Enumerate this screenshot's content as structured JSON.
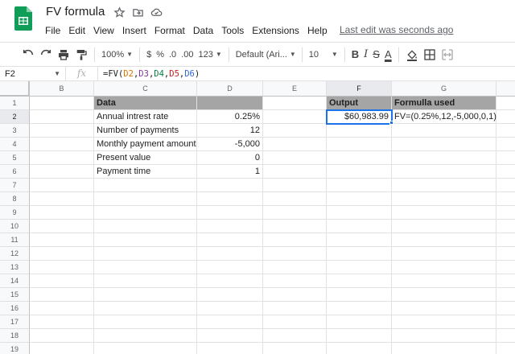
{
  "doc": {
    "title": "FV formula",
    "last_edit": "Last edit was seconds ago"
  },
  "menu": [
    "File",
    "Edit",
    "View",
    "Insert",
    "Format",
    "Data",
    "Tools",
    "Extensions",
    "Help"
  ],
  "toolbar": {
    "zoom": "100%",
    "currency": "$",
    "percent": "%",
    "dec_decrease": ".0",
    "dec_increase": ".00",
    "more_formats": "123",
    "font": "Default (Ari...",
    "font_size": "10",
    "bold": "B",
    "italic": "I",
    "strike": "S",
    "text_color": "A"
  },
  "formula_bar": {
    "name_box": "F2",
    "fx": "fx",
    "formula_prefix": "=FV(",
    "refs": [
      "D2",
      "D3",
      "D4",
      "D5",
      "D6"
    ],
    "comma": ",",
    "close": ")"
  },
  "columns": [
    "B",
    "C",
    "D",
    "E",
    "F",
    "G"
  ],
  "rows": [
    "1",
    "2",
    "3",
    "4",
    "5",
    "6",
    "7",
    "8",
    "9",
    "10",
    "11",
    "12",
    "13",
    "14",
    "15",
    "16",
    "17",
    "18",
    "19"
  ],
  "table": {
    "header_label": "Data",
    "labels": [
      "Annual intrest rate",
      "Number of payments",
      "Monthly payment amount",
      "Present value",
      "Payment time"
    ],
    "values": [
      "0.25%",
      "12",
      "-5,000",
      "0",
      "1"
    ]
  },
  "output": {
    "header": "Output",
    "value": "$60,983.99"
  },
  "formula_used": {
    "header": "Formulla used",
    "value": "FV=(0.25%,12,-5,000,0,1)"
  },
  "colors": {
    "header_fill": "#a5a5a5",
    "selection": "#1a73e8",
    "logo_green": "#0f9d58"
  }
}
